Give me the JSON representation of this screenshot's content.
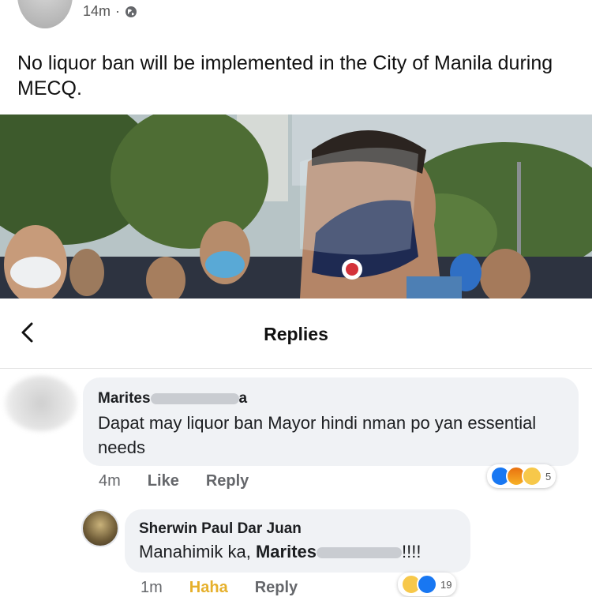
{
  "post": {
    "time": "14m",
    "separator": "·",
    "text": "No liquor ban will be implemented in the City of Manila during MECQ."
  },
  "replies_header": {
    "title": "Replies"
  },
  "comments": [
    {
      "author": "Marites",
      "author_suffix": "a",
      "body": "Dapat may liquor ban Mayor hindi nman po yan essential needs",
      "time": "4m",
      "like_label": "Like",
      "reply_label": "Reply",
      "reaction_count": "5"
    },
    {
      "author": "Sherwin Paul Dar Juan",
      "body_prefix": "Manahimik ka, ",
      "mention": "Marites",
      "body_suffix": "!!!!",
      "time": "1m",
      "haha_label": "Haha",
      "reply_label": "Reply",
      "reaction_count": "19"
    }
  ],
  "colors": {
    "bubble": "#f0f2f5",
    "like_blue": "#1877f2",
    "haha_yellow": "#e6b02b",
    "meta_gray": "#65676b"
  },
  "icons": [
    "globe-icon",
    "back-icon",
    "like-reaction-icon",
    "angry-reaction-icon",
    "haha-reaction-icon"
  ]
}
